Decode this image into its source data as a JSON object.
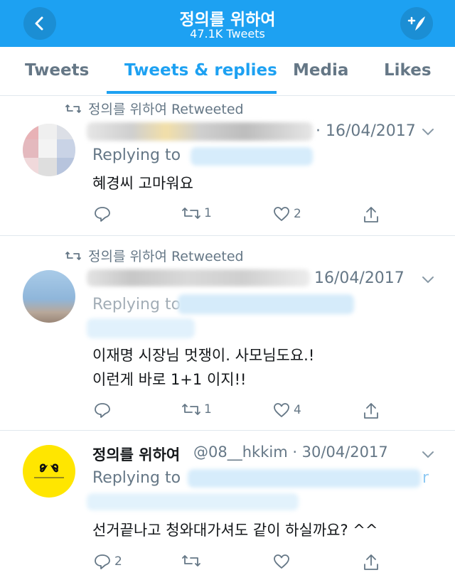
{
  "header": {
    "title": "정의를 위하여",
    "subtitle": "47.1K Tweets"
  },
  "tabs": [
    {
      "label": "Tweets"
    },
    {
      "label": "Tweets & replies"
    },
    {
      "label": "Media"
    },
    {
      "label": "Likes"
    }
  ],
  "tweets": [
    {
      "retweet_label": "정의를 위하여 Retweeted",
      "date": "· 16/04/2017",
      "reply_label": "Replying to",
      "text": "혜경씨 고마워요",
      "retweets": "1",
      "likes": "2"
    },
    {
      "retweet_label": "정의를 위하여 Retweeted",
      "date": "16/04/2017",
      "reply_label": "Replying to",
      "text_line1": "이재명 시장님 멋쟁이.  사모님도요.!",
      "text_line2": "이런게 바로 1+1 이지!!",
      "retweets": "1",
      "likes": "4"
    },
    {
      "name": "정의를 위하여",
      "handle": "@08__hkkim · 30/04/2017",
      "reply_label": "Replying to",
      "reply_tail": "r",
      "text": "선거끝나고 청와대가셔도 같이 하실까요? ^^",
      "replies": "2"
    }
  ],
  "icons": [
    "back-arrow-icon",
    "compose-icon",
    "retweet-icon",
    "reply-icon",
    "like-icon",
    "share-icon",
    "chevron-down-icon"
  ],
  "colors": {
    "accent": "#1da1f2",
    "muted": "#657786",
    "text": "#14171a",
    "avatar_yellow": "#ffe600"
  }
}
